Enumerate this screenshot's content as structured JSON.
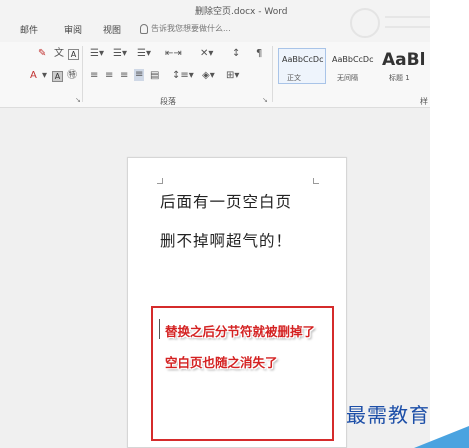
{
  "window": {
    "title": "删除空页.docx - Word"
  },
  "tabs": [
    {
      "label": "邮件"
    },
    {
      "label": "审阅"
    },
    {
      "label": "视图"
    }
  ],
  "tell_me": {
    "placeholder": "告诉我您想要做什么..."
  },
  "ribbon": {
    "paragraph_group_label": "段落",
    "styles": [
      {
        "sample": "AaBbCcDc",
        "name": "正文"
      },
      {
        "sample": "AaBbCcDc",
        "name": "无间隔"
      },
      {
        "sample": "AaBl",
        "name": "标题 1"
      }
    ],
    "styles_group_label_partial": "样"
  },
  "document": {
    "lines": [
      "后面有一页空白页",
      "删不掉啊超气的！"
    ],
    "annotation": [
      "替换之后分节符就被删掉了",
      "空白页也随之消失了"
    ]
  },
  "watermark": {
    "text": "最需教育"
  },
  "colors": {
    "annotation_red": "#d42222",
    "box_red": "#d52b2b",
    "watermark_blue": "#1d4fa8"
  }
}
